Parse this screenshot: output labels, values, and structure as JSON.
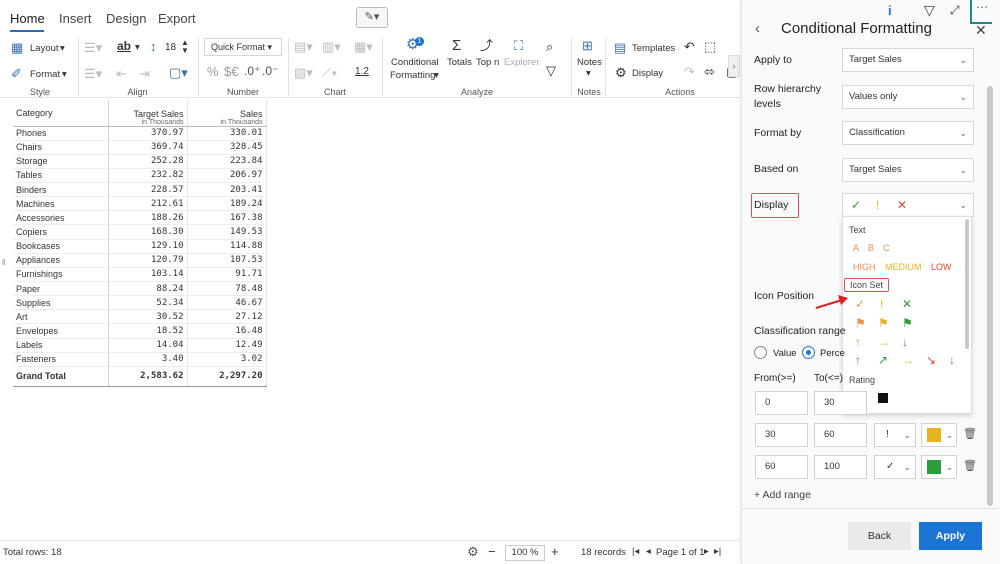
{
  "tabs": [
    "Home",
    "Insert",
    "Design",
    "Export"
  ],
  "ribbon": {
    "style": {
      "layout": "Layout",
      "format": "Format",
      "label": "Style"
    },
    "align": {
      "label": "Align",
      "font_size": "18",
      "ab": "ab"
    },
    "number": {
      "quick_format": "Quick Format",
      "label": "Number",
      "percent": "%",
      "currency": "$€",
      "inc": ".0⁺",
      "dec": ".0⁻",
      "one_two": "1.2"
    },
    "chart": {
      "label": "Chart"
    },
    "analyze": {
      "conditional": "Conditional",
      "formatting": "Formatting",
      "totals": "Totals",
      "topn": "Top n",
      "explorer": "Explorer",
      "label": "Analyze"
    },
    "notes": {
      "notes": "Notes",
      "label": "Notes"
    },
    "actions": {
      "templates": "Templates",
      "display": "Display",
      "label": "Actions"
    }
  },
  "grid": {
    "header": {
      "category": "Category",
      "col1": "Target Sales",
      "col1_sub": "in Thousands",
      "col2": "Sales",
      "col2_sub": "in Thousands"
    },
    "rows": [
      [
        "Phones",
        "370.97",
        "330.01"
      ],
      [
        "Chairs",
        "369.74",
        "328.45"
      ],
      [
        "Storage",
        "252.28",
        "223.84"
      ],
      [
        "Tables",
        "232.82",
        "206.97"
      ],
      [
        "Binders",
        "228.57",
        "203.41"
      ],
      [
        "Machines",
        "212.61",
        "189.24"
      ],
      [
        "Accessories",
        "188.26",
        "167.38"
      ],
      [
        "Copiers",
        "168.30",
        "149.53"
      ],
      [
        "Bookcases",
        "129.10",
        "114.88"
      ],
      [
        "Appliances",
        "120.79",
        "107.53"
      ],
      [
        "Furnishings",
        "103.14",
        "91.71"
      ],
      [
        "Paper",
        "88.24",
        "78.48"
      ],
      [
        "Supplies",
        "52.34",
        "46.67"
      ],
      [
        "Art",
        "30.52",
        "27.12"
      ],
      [
        "Envelopes",
        "18.52",
        "16.48"
      ],
      [
        "Labels",
        "14.04",
        "12.49"
      ],
      [
        "Fasteners",
        "3.40",
        "3.02"
      ]
    ],
    "total": [
      "Grand Total",
      "2,583.62",
      "2,297.20"
    ]
  },
  "status": {
    "total_rows": "Total rows: 18",
    "zoom": "100 %",
    "records": "18 records",
    "page": "Page 1 of 1"
  },
  "panel": {
    "title": "Conditional Formatting",
    "apply_to_label": "Apply to",
    "apply_to_value": "Target Sales",
    "row_hierarchy_label": "Row hierarchy levels",
    "row_hierarchy_value": "Values only",
    "format_by_label": "Format by",
    "format_by_value": "Classification",
    "based_on_label": "Based on",
    "based_on_value": "Target Sales",
    "display_label": "Display",
    "icon_position_label": "Icon Position",
    "classification_label": "Classification range",
    "radio_value": "Value",
    "radio_percent": "Perce",
    "from_label": "From(>=)",
    "to_label": "To(<=)",
    "ranges": [
      {
        "from": "0",
        "to": "30",
        "icon": "",
        "color": "#e04b3a"
      },
      {
        "from": "30",
        "to": "60",
        "icon": "!",
        "color": "#e6b422"
      },
      {
        "from": "60",
        "to": "100",
        "icon": "✓",
        "color": "#2e9e3a"
      }
    ],
    "add_range": "+ Add range",
    "back": "Back",
    "apply": "Apply"
  },
  "dropdown": {
    "text_header": "Text",
    "abc": [
      "A",
      "B",
      "C"
    ],
    "hml": [
      "HIGH",
      "MEDIUM",
      "LOW"
    ],
    "icon_set_header": "Icon Set",
    "rating_header": "Rating"
  },
  "colors": {
    "accent": "#1b74d4",
    "red": "#e04b3a",
    "amber": "#e6b422",
    "green": "#2e9e3a",
    "highlight": "#e05050"
  }
}
